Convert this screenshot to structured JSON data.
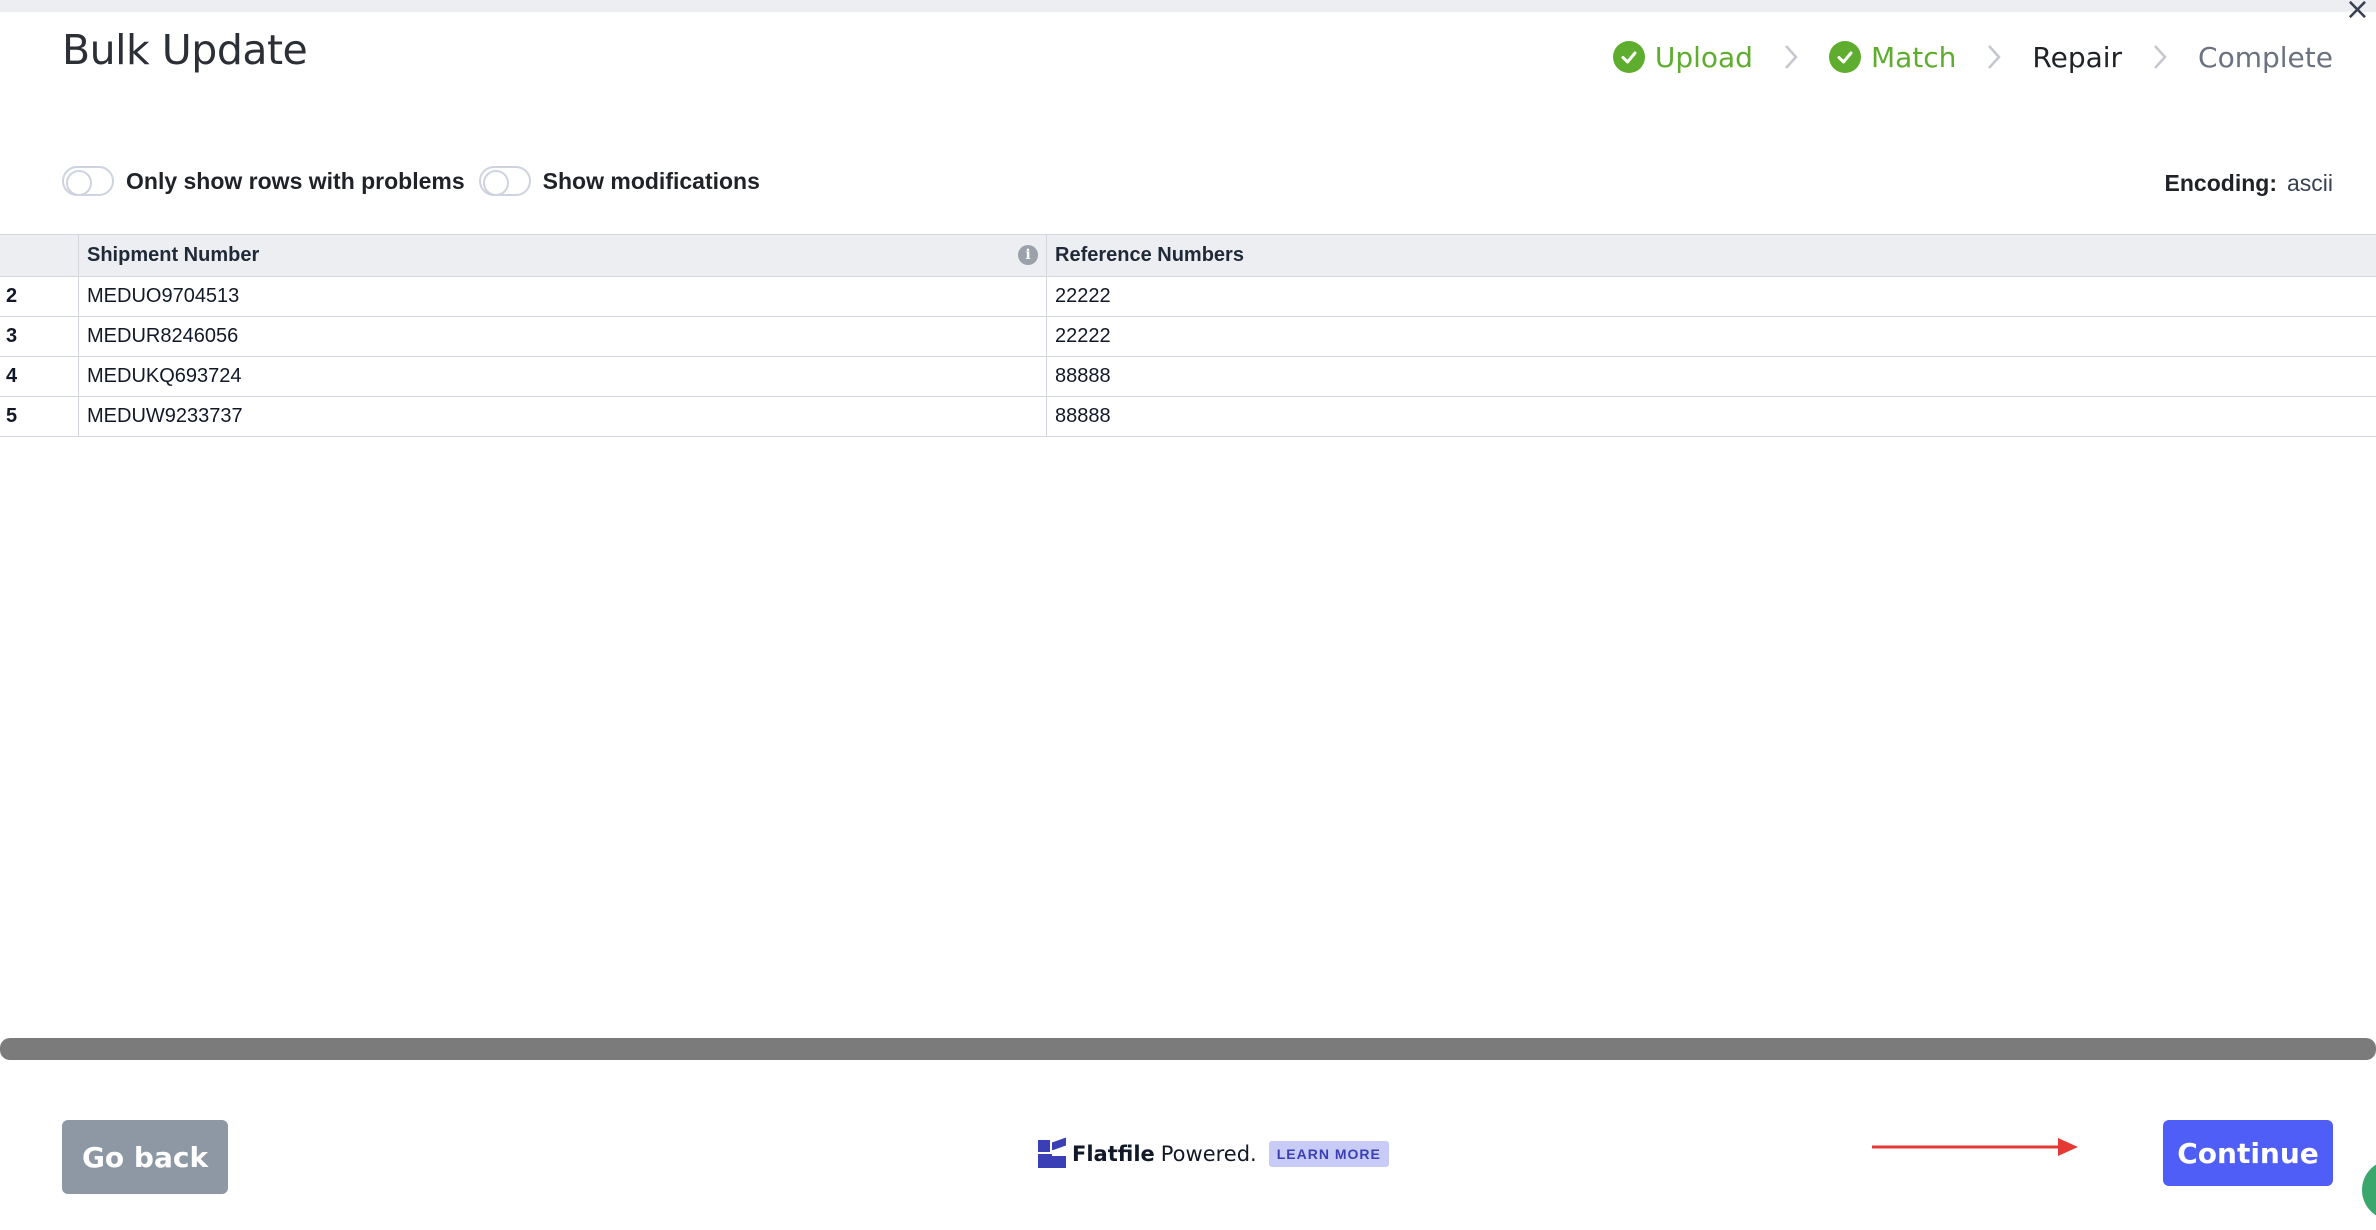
{
  "header": {
    "title": "Bulk Update",
    "close_icon": "close-icon"
  },
  "steps": [
    {
      "label": "Upload",
      "state": "done"
    },
    {
      "label": "Match",
      "state": "done"
    },
    {
      "label": "Repair",
      "state": "current"
    },
    {
      "label": "Complete",
      "state": "pending"
    }
  ],
  "toolbar": {
    "toggle_problems_label": "Only show rows with problems",
    "toggle_modifications_label": "Show modifications",
    "encoding_label": "Encoding:",
    "encoding_value": "ascii"
  },
  "table": {
    "columns": [
      "",
      "Shipment Number",
      "Reference Numbers"
    ],
    "rows": [
      {
        "index": "2",
        "shipment": "MEDUO9704513",
        "reference": "22222"
      },
      {
        "index": "3",
        "shipment": "MEDUR8246056",
        "reference": "22222"
      },
      {
        "index": "4",
        "shipment": "MEDUKQ693724",
        "reference": "88888"
      },
      {
        "index": "5",
        "shipment": "MEDUW9233737",
        "reference": "88888"
      }
    ]
  },
  "footer": {
    "go_back_label": "Go back",
    "brand_name": "Flatfile",
    "brand_powered": "Powered.",
    "learn_more_label": "LEARN MORE",
    "continue_label": "Continue"
  },
  "colors": {
    "done": "#5fad2e",
    "primary": "#4f5ef7",
    "annotation_arrow": "#e53935"
  }
}
